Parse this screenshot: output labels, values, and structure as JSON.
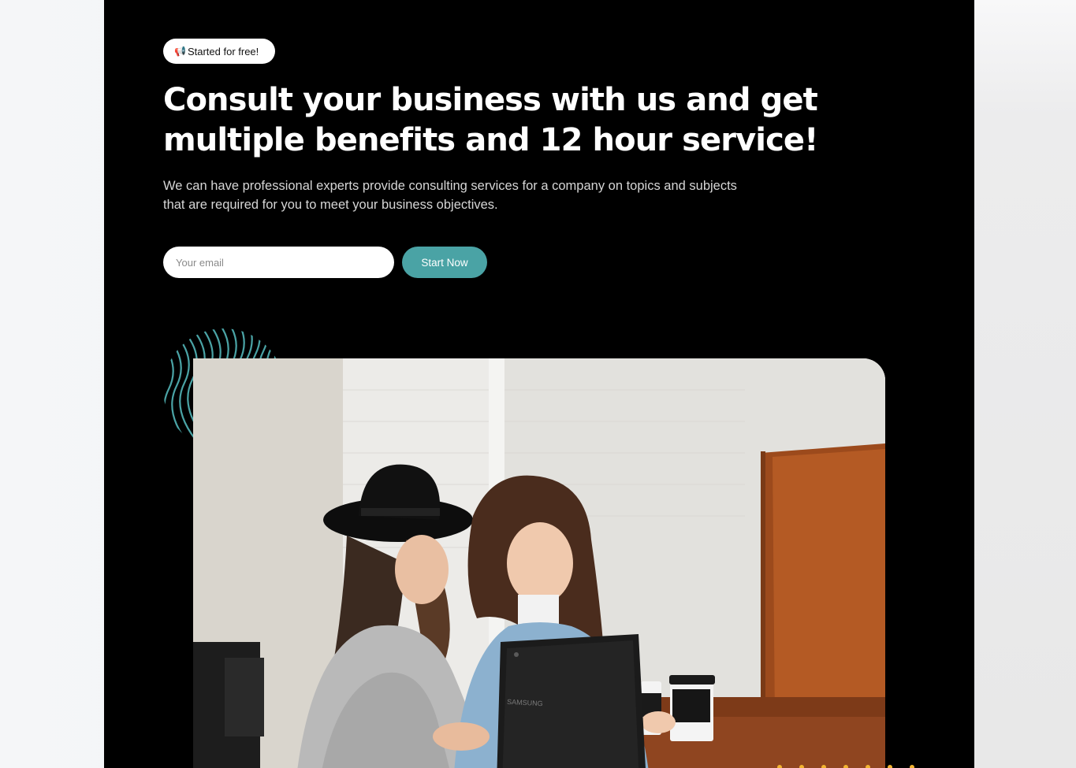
{
  "hero": {
    "badge_icon": "megaphone-icon",
    "badge_label": "Started for free!",
    "headline": "Consult your business with us and get multiple benefits and 12 hour service!",
    "subtext": "We can have professional experts provide consulting services for a company on topics and subjects that are required for you to meet your business objectives.",
    "email_placeholder": "Your email",
    "cta_label": "Start Now",
    "photo_brand_text": "SAMSUNG"
  },
  "colors": {
    "hero_background": "#000000",
    "accent_teal": "#4aa3a5",
    "dot_accent": "#f2b431",
    "page_background": "#f5f6f8"
  }
}
